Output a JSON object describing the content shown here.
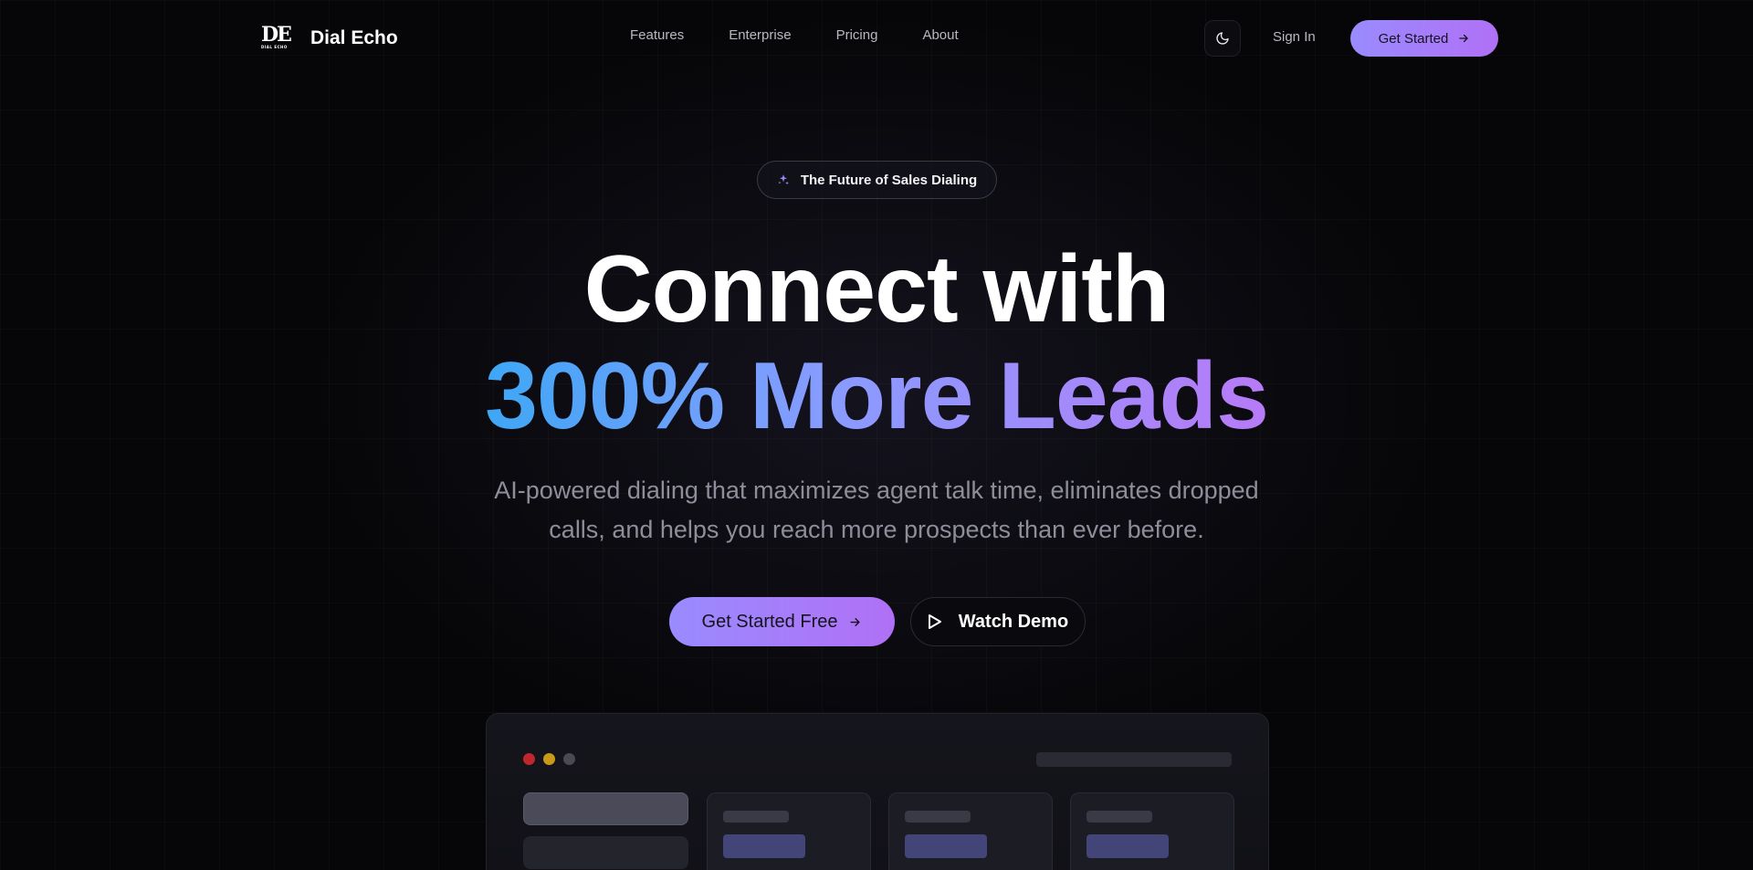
{
  "brand": {
    "logo_mark": "DE",
    "logo_subtext": "DIAL ECHO",
    "name": "Dial Echo"
  },
  "nav": {
    "links": [
      "Features",
      "Enterprise",
      "Pricing",
      "About"
    ],
    "theme_toggle_icon": "moon-icon",
    "signin_label": "Sign In",
    "cta_label": "Get Started",
    "cta_icon": "arrow-right-icon"
  },
  "hero": {
    "badge_icon": "sparkles-icon",
    "badge_text": "The Future of Sales Dialing",
    "headline_line1": "Connect with",
    "headline_line2": "300% More Leads",
    "subtext_line1": "AI-powered dialing that maximizes agent talk time, eliminates dropped",
    "subtext_line2": "calls, and helps you reach more prospects than ever before.",
    "primary_cta": "Get Started Free",
    "secondary_cta": "Watch Demo",
    "secondary_cta_icon": "play-icon"
  },
  "colors": {
    "accent_gradient_start": "#9a8bff",
    "accent_gradient_end": "#b070f5",
    "headline_gradient": [
      "#3fa7f5",
      "#8a9bff",
      "#b77bf7"
    ],
    "window_dots": [
      "#c0272d",
      "#c99a17",
      "#4a4a52"
    ]
  }
}
